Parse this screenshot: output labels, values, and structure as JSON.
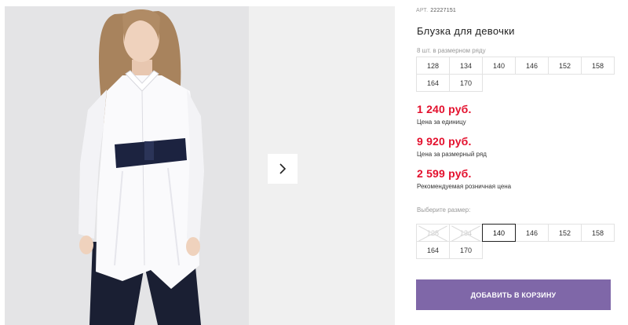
{
  "gallery": {
    "photo_alt": "model-photo",
    "next_icon": "chevron-right-icon"
  },
  "product": {
    "article_label": "АРТ.",
    "article_value": "22227151",
    "title": "Блузка для девочки",
    "row_note": "8 шт. в размерном ряду",
    "row_sizes": [
      "128",
      "134",
      "140",
      "146",
      "152",
      "158",
      "164",
      "170"
    ],
    "prices": [
      {
        "value": "1 240 руб.",
        "note": "Цена за единицу"
      },
      {
        "value": "9 920 руб.",
        "note": "Цена за размерный ряд"
      },
      {
        "value": "2 599 руб.",
        "note": "Рекомендуемая розничная цена"
      }
    ],
    "choose_label": "Выберите размер:",
    "select_sizes": [
      {
        "label": "128",
        "state": "disabled"
      },
      {
        "label": "134",
        "state": "disabled"
      },
      {
        "label": "140",
        "state": "selected"
      },
      {
        "label": "146",
        "state": "available"
      },
      {
        "label": "152",
        "state": "available"
      },
      {
        "label": "158",
        "state": "available"
      },
      {
        "label": "164",
        "state": "available"
      },
      {
        "label": "170",
        "state": "available"
      }
    ],
    "cart_button": "ДОБАВИТЬ В КОРЗИНУ"
  },
  "colors": {
    "price_red": "#e3102d",
    "cart_purple": "#7f67a8",
    "belt_navy": "#1c2340"
  }
}
